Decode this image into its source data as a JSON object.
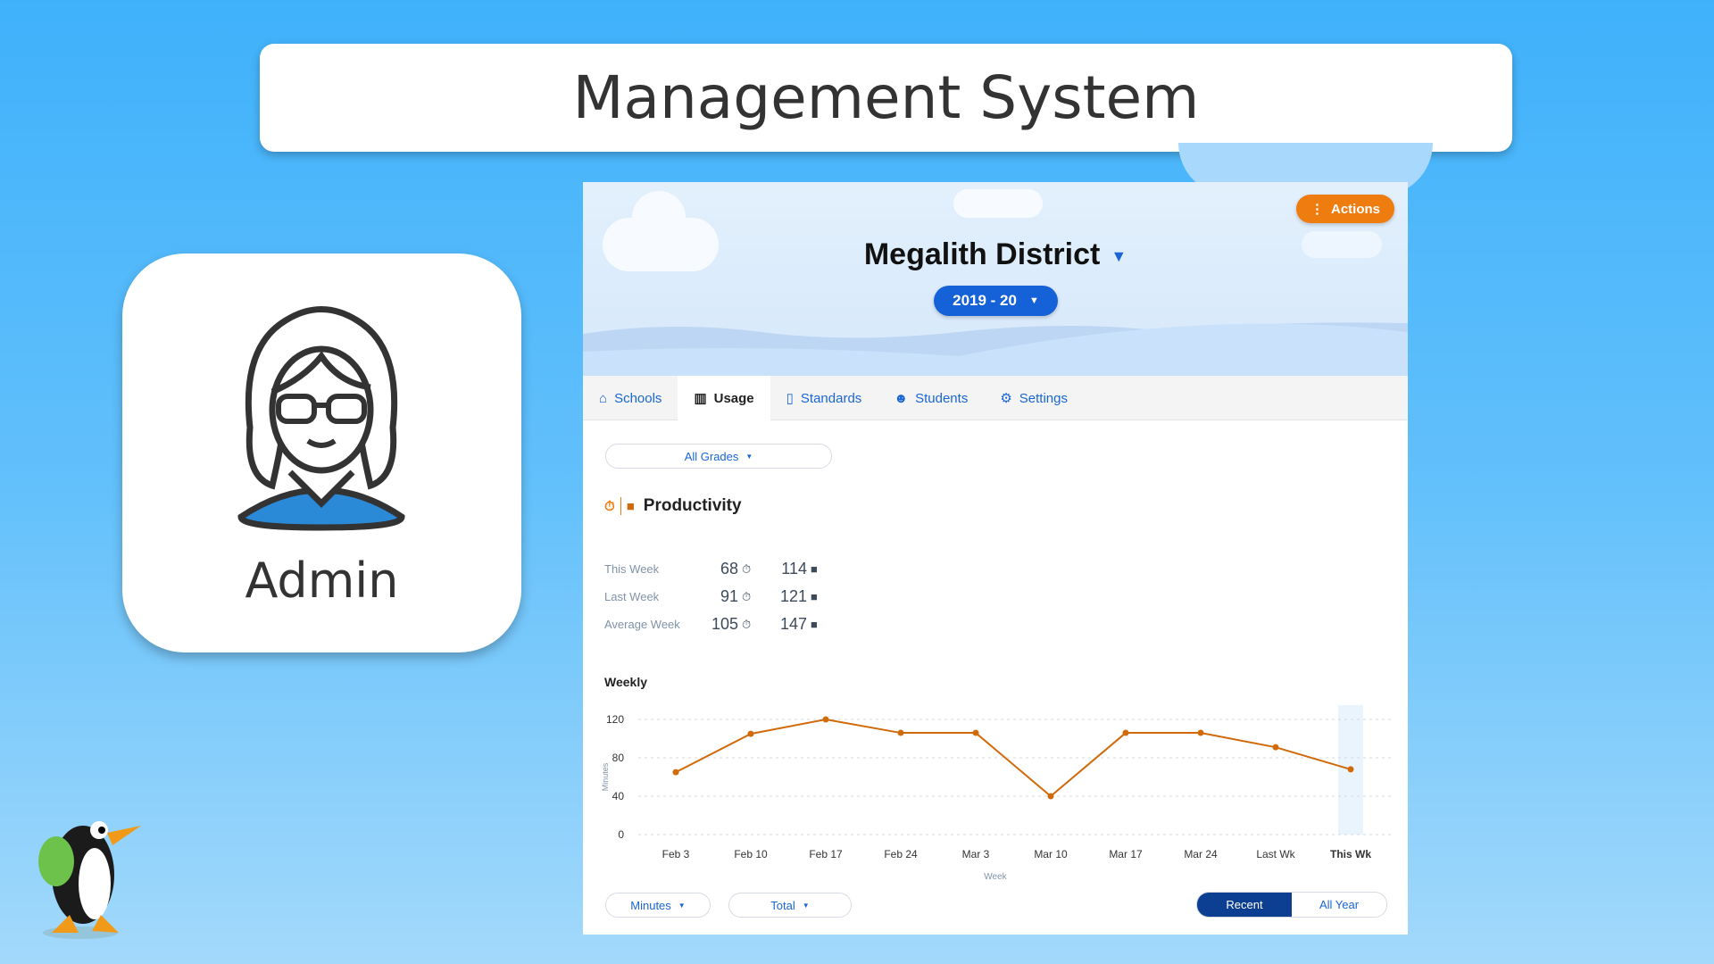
{
  "slide": {
    "title": "Management System",
    "role_label": "Admin"
  },
  "header": {
    "actions_label": "Actions",
    "district": "Megalith District",
    "year": "2019 - 20"
  },
  "tabs": [
    {
      "label": "Schools",
      "icon": "school-icon"
    },
    {
      "label": "Usage",
      "icon": "bar-chart-icon",
      "active": true
    },
    {
      "label": "Standards",
      "icon": "clipboard-icon"
    },
    {
      "label": "Students",
      "icon": "student-icon"
    },
    {
      "label": "Settings",
      "icon": "gear-icon"
    }
  ],
  "filters": {
    "grades": "All Grades"
  },
  "productivity": {
    "title": "Productivity",
    "rows": [
      {
        "label": "This Week",
        "minutes": "68",
        "lessons": "114"
      },
      {
        "label": "Last Week",
        "minutes": "91",
        "lessons": "121"
      },
      {
        "label": "Average Week",
        "minutes": "105",
        "lessons": "147"
      }
    ]
  },
  "colors": {
    "accent": "#ef7c0e",
    "primary": "#1461d8",
    "line": "#d06a0a"
  },
  "chart_data": {
    "type": "line",
    "title": "Weekly",
    "xlabel": "Week",
    "ylabel": "Minutes",
    "categories": [
      "Feb 3",
      "Feb 10",
      "Feb 17",
      "Feb 24",
      "Mar 3",
      "Mar 10",
      "Mar 17",
      "Mar 24",
      "Last Wk",
      "This Wk"
    ],
    "values": [
      65,
      105,
      120,
      106,
      106,
      40,
      106,
      106,
      91,
      68
    ],
    "yticks": [
      0,
      40,
      80,
      120
    ],
    "ylim": [
      0,
      120
    ],
    "grid": true,
    "highlight": "This Wk"
  },
  "controls": {
    "metric": "Minutes",
    "aggregate": "Total",
    "range_options": [
      "Recent",
      "All Year"
    ],
    "range_selected": "Recent"
  }
}
